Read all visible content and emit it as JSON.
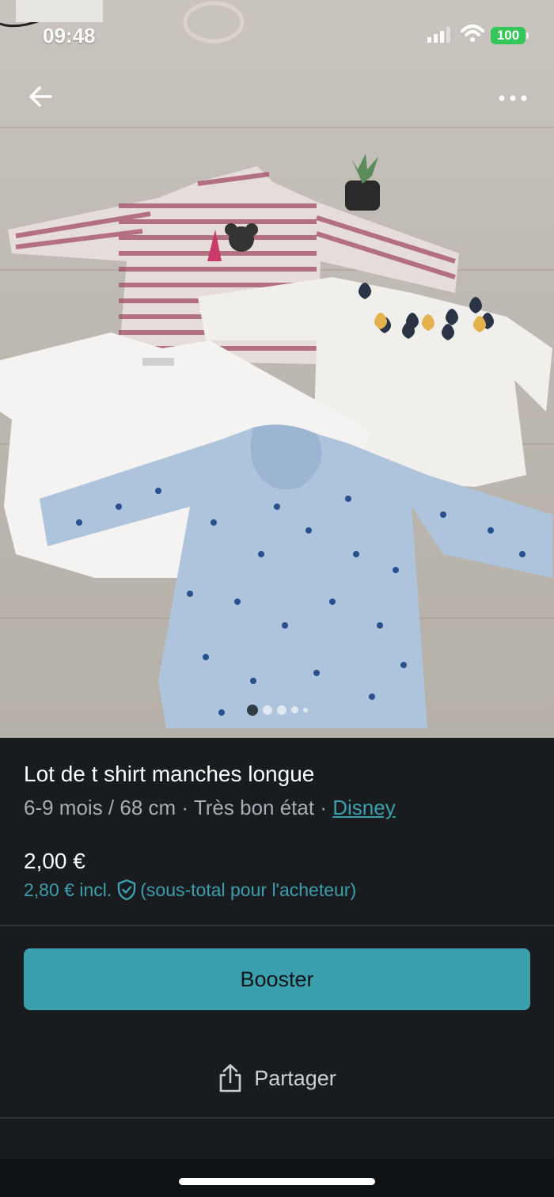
{
  "status_bar": {
    "time": "09:48",
    "battery": "100"
  },
  "listing": {
    "title": "Lot de t shirt manches longue",
    "size": "6-9 mois / 68 cm",
    "separator": "·",
    "condition": "Très bon état",
    "brand": "Disney",
    "price": "2,00 €",
    "buyer_price": "2,80 € incl.",
    "buyer_note": "(sous-total pour l'acheteur)"
  },
  "gallery": {
    "total_images": 5,
    "active_index": 0
  },
  "actions": {
    "booster_label": "Booster",
    "share_label": "Partager"
  },
  "colors": {
    "accent": "#3b9fae",
    "background": "#181c1f",
    "battery": "#35c759"
  },
  "icons": {
    "back": "arrow-left-icon",
    "more": "more-horizontal-icon",
    "shield": "shield-check-icon",
    "share": "share-icon"
  }
}
